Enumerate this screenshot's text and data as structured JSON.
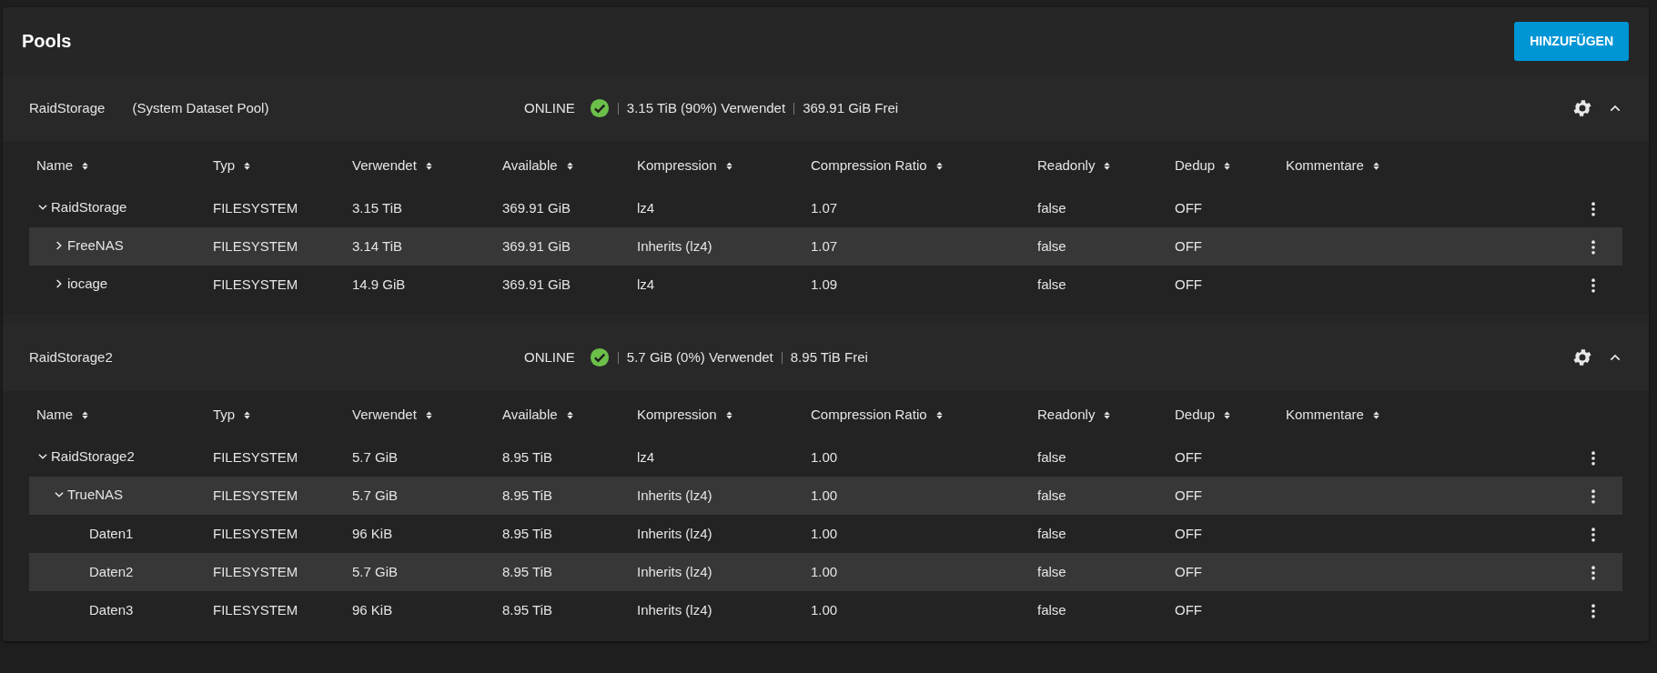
{
  "page": {
    "title": "Pools",
    "add_button": "HINZUFÜGEN"
  },
  "pools": [
    {
      "name": "RaidStorage",
      "subtitle": "(System Dataset Pool)",
      "status": "ONLINE",
      "used": "3.15 TiB (90%) Verwendet",
      "free": "369.91 GiB Frei",
      "expanded": true,
      "columns": [
        "Name",
        "Typ",
        "Verwendet",
        "Available",
        "Kompression",
        "Compression Ratio",
        "Readonly",
        "Dedup",
        "Kommentare"
      ],
      "datasets": [
        {
          "name": "RaidStorage",
          "type": "FILESYSTEM",
          "used": "3.15 TiB",
          "available": "369.91 GiB",
          "compression": "lz4",
          "ratio": "1.07",
          "readonly": "false",
          "dedup": "OFF",
          "expanded": true,
          "children": [
            {
              "name": "FreeNAS",
              "type": "FILESYSTEM",
              "used": "3.14 TiB",
              "available": "369.91 GiB",
              "compression": "Inherits (lz4)",
              "ratio": "1.07",
              "readonly": "false",
              "dedup": "OFF",
              "expanded": false
            },
            {
              "name": "iocage",
              "type": "FILESYSTEM",
              "used": "14.9 GiB",
              "available": "369.91 GiB",
              "compression": "lz4",
              "ratio": "1.09",
              "readonly": "false",
              "dedup": "OFF",
              "expanded": false
            }
          ]
        }
      ]
    },
    {
      "name": "RaidStorage2",
      "status": "ONLINE",
      "used": "5.7 GiB (0%) Verwendet",
      "free": "8.95 TiB Frei",
      "expanded": true,
      "columns": [
        "Name",
        "Typ",
        "Verwendet",
        "Available",
        "Kompression",
        "Compression Ratio",
        "Readonly",
        "Dedup",
        "Kommentare"
      ],
      "datasets": [
        {
          "name": "RaidStorage2",
          "type": "FILESYSTEM",
          "used": "5.7 GiB",
          "available": "8.95 TiB",
          "compression": "lz4",
          "ratio": "1.00",
          "readonly": "false",
          "dedup": "OFF",
          "expanded": true,
          "children": [
            {
              "name": "TrueNAS",
              "type": "FILESYSTEM",
              "used": "5.7 GiB",
              "available": "8.95 TiB",
              "compression": "Inherits (lz4)",
              "ratio": "1.00",
              "readonly": "false",
              "dedup": "OFF",
              "expanded": true,
              "children": [
                {
                  "name": "Daten1",
                  "type": "FILESYSTEM",
                  "used": "96 KiB",
                  "available": "8.95 TiB",
                  "compression": "Inherits (lz4)",
                  "ratio": "1.00",
                  "readonly": "false",
                  "dedup": "OFF"
                },
                {
                  "name": "Daten2",
                  "type": "FILESYSTEM",
                  "used": "5.7 GiB",
                  "available": "8.95 TiB",
                  "compression": "Inherits (lz4)",
                  "ratio": "1.00",
                  "readonly": "false",
                  "dedup": "OFF"
                },
                {
                  "name": "Daten3",
                  "type": "FILESYSTEM",
                  "used": "96 KiB",
                  "available": "8.95 TiB",
                  "compression": "Inherits (lz4)",
                  "ratio": "1.00",
                  "readonly": "false",
                  "dedup": "OFF"
                }
              ]
            }
          ]
        }
      ]
    }
  ]
}
